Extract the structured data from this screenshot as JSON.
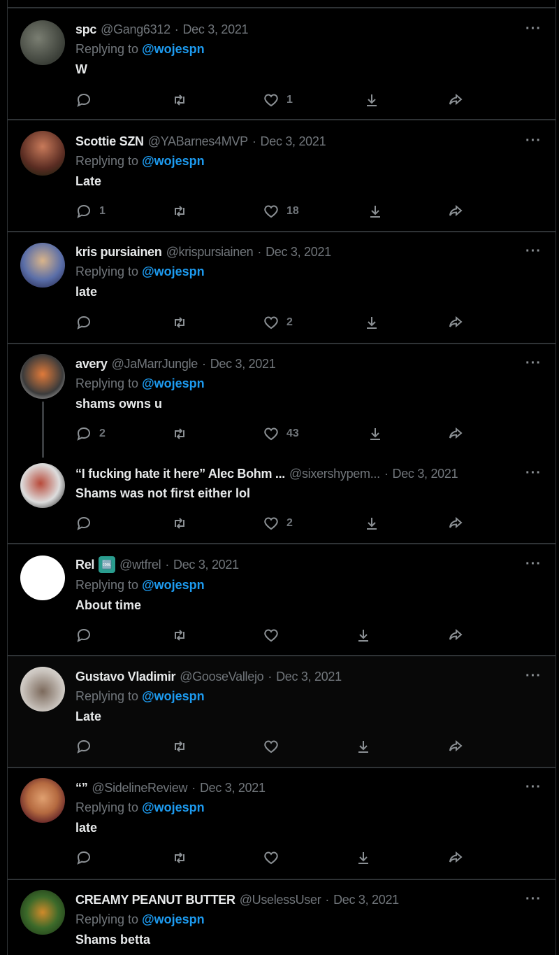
{
  "reply_prefix": "Replying to",
  "more_label": "···",
  "colors": {
    "accent": "#1d9bf0",
    "muted": "#71767b",
    "background": "#000000"
  },
  "tweets": [
    {
      "name": "spc",
      "handle": "@Gang6312",
      "date": "Dec 3, 2021",
      "mention": "@wojespn",
      "text": "W",
      "replies": "",
      "likes": "1"
    },
    {
      "name": "Scottie SZN",
      "handle": "@YABarnes4MVP",
      "date": "Dec 3, 2021",
      "mention": "@wojespn",
      "text": "Late",
      "replies": "1",
      "likes": "18"
    },
    {
      "name": "kris pursiainen",
      "handle": "@krispursiainen",
      "date": "Dec 3, 2021",
      "mention": "@wojespn",
      "text": "late",
      "replies": "",
      "likes": "2"
    },
    {
      "name": "avery",
      "handle": "@JaMarrJungle",
      "date": "Dec 3, 2021",
      "mention": "@wojespn",
      "text": "shams owns u",
      "replies": "2",
      "likes": "43"
    },
    {
      "name": "“I fucking hate it here” Alec Bohm ...",
      "handle": "@sixershypem...",
      "date": "Dec 3, 2021",
      "mention": "",
      "text": "Shams was not first either lol",
      "replies": "",
      "likes": "2"
    },
    {
      "name": "Rel",
      "name_emoji": "🆒",
      "handle": "@wtfrel",
      "date": "Dec 3, 2021",
      "mention": "@wojespn",
      "text": "About time",
      "replies": "",
      "likes": ""
    },
    {
      "name": "Gustavo Vladimir",
      "handle": "@GooseVallejo",
      "date": "Dec 3, 2021",
      "mention": "@wojespn",
      "text": "Late",
      "replies": "",
      "likes": ""
    },
    {
      "name": "“”",
      "handle": "@SidelineReview",
      "date": "Dec 3, 2021",
      "mention": "@wojespn",
      "text": "late",
      "replies": "",
      "likes": ""
    },
    {
      "name": "CREAMY PEANUT BUTTER",
      "handle": "@UselessUser",
      "date": "Dec 3, 2021",
      "mention": "@wojespn",
      "text": "Shams betta",
      "replies": "",
      "likes": ""
    }
  ]
}
